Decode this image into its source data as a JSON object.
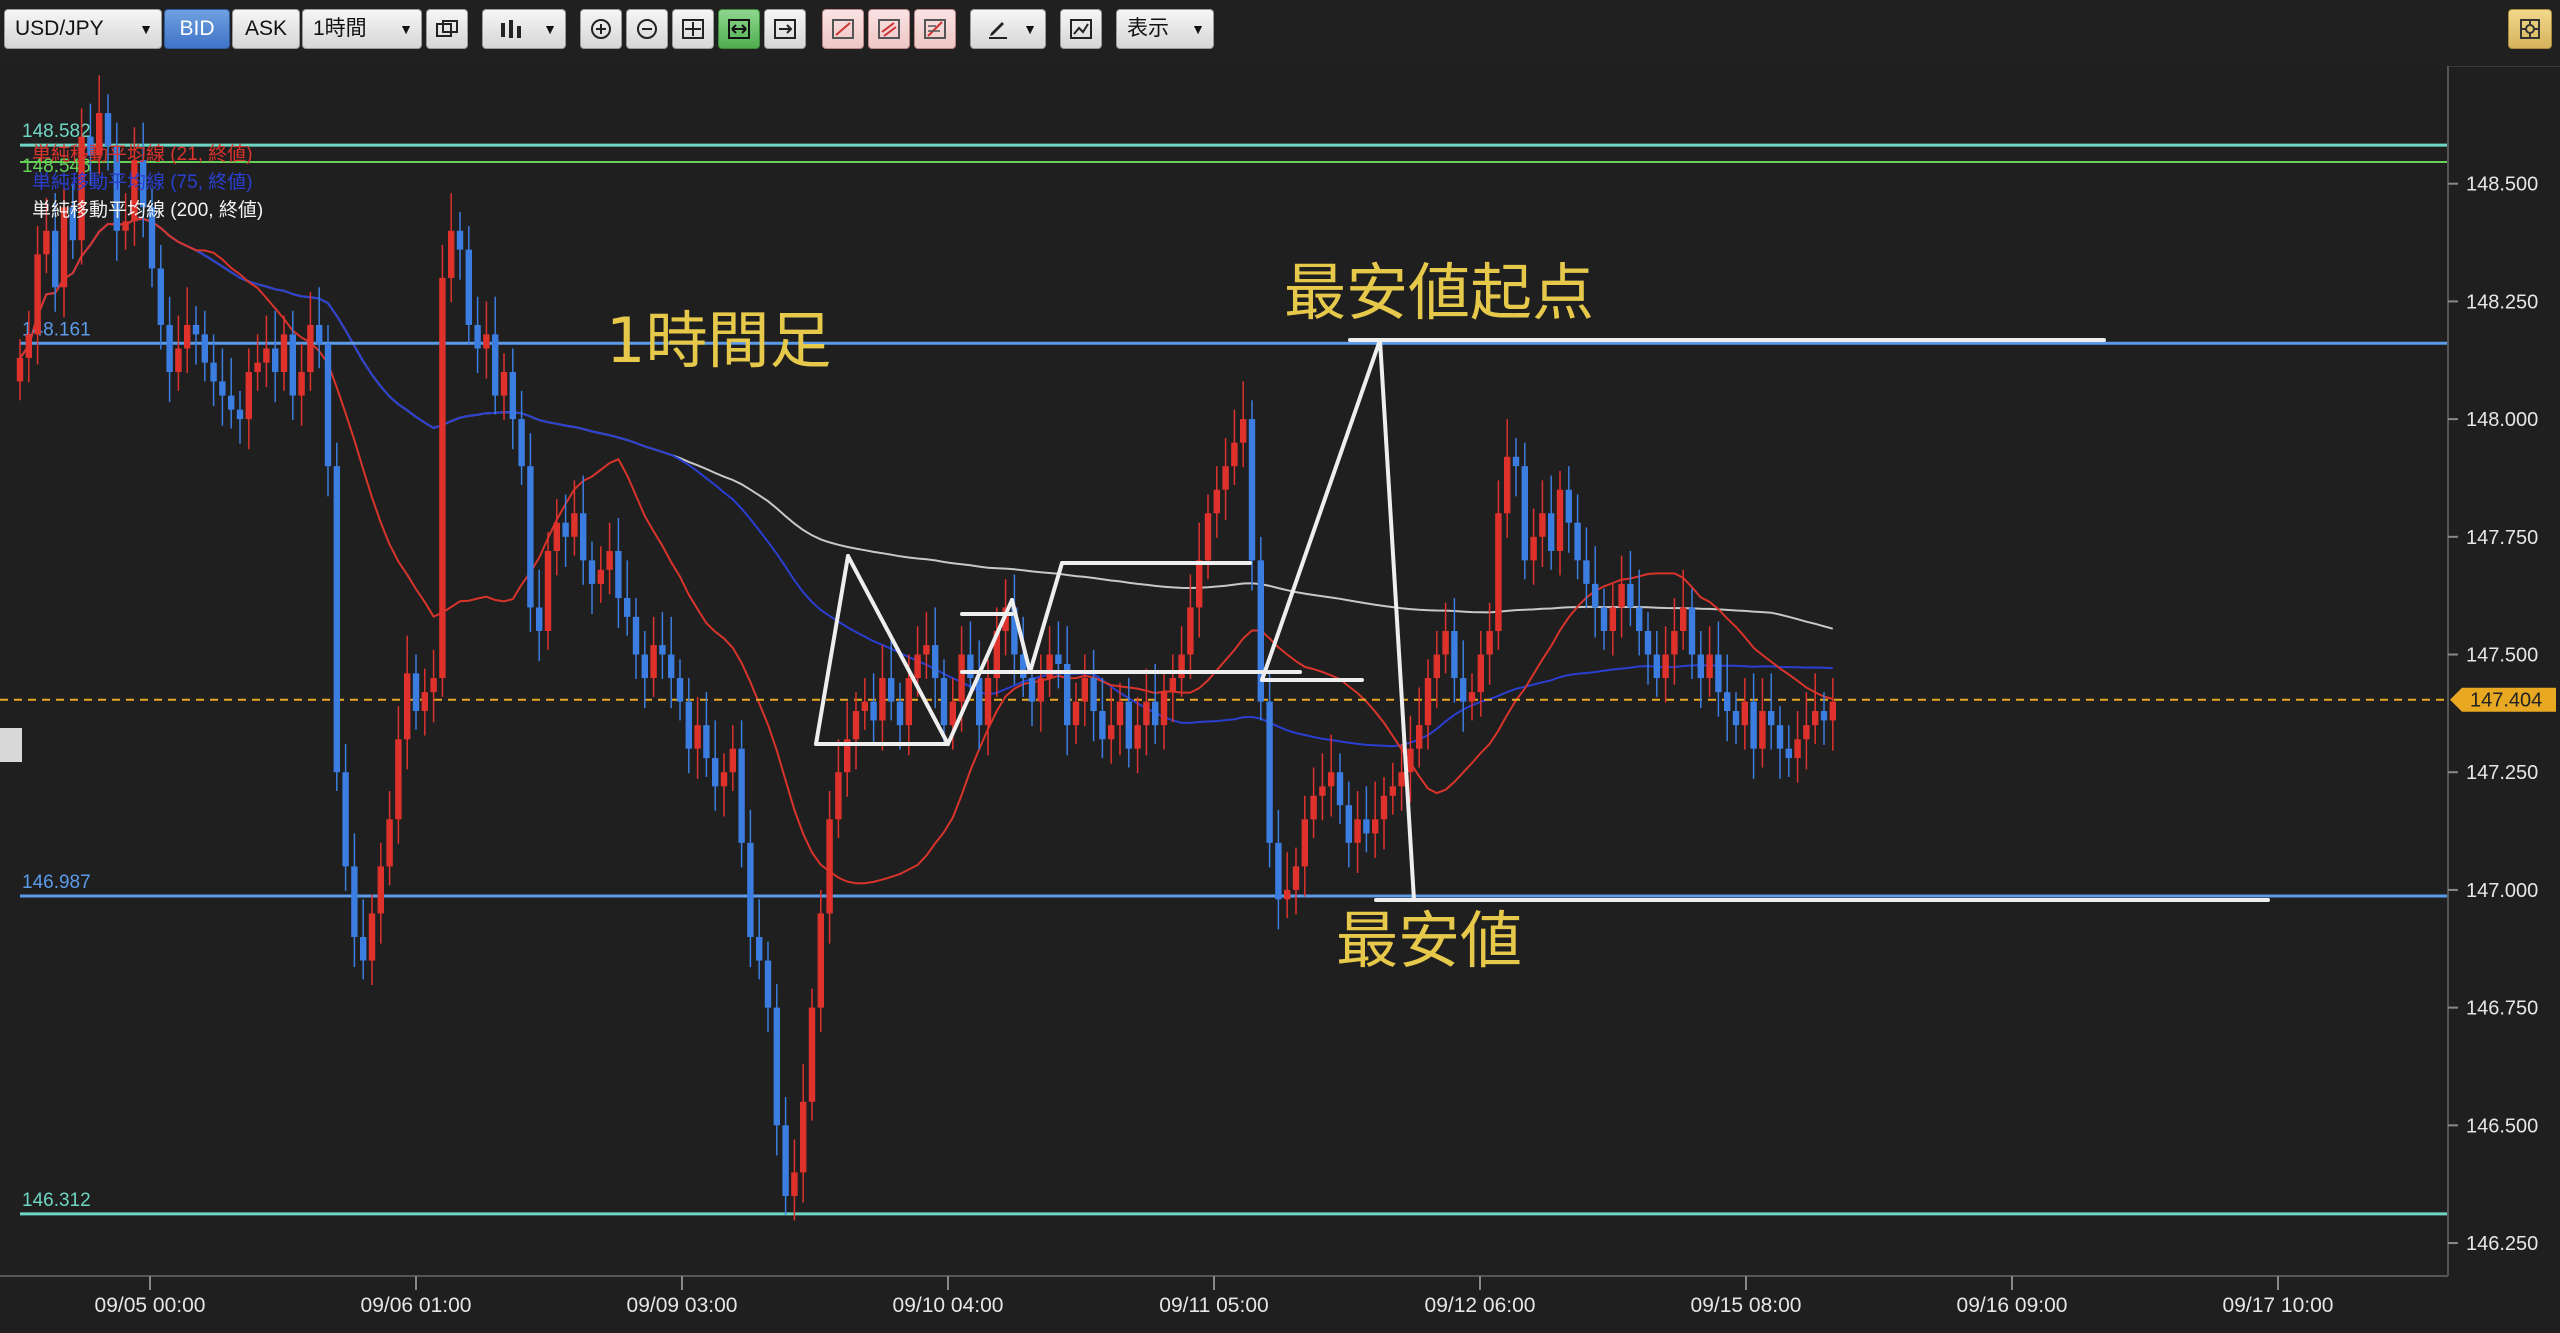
{
  "toolbar": {
    "symbol": "USD/JPY",
    "bid_label": "BID",
    "ask_label": "ASK",
    "timeframe": "1時間",
    "display_label": "表示"
  },
  "colors": {
    "background": "#1f1f1f",
    "up_candle": "#e0322d",
    "down_candle": "#3b7de0",
    "ma21": "#d8342c",
    "ma75": "#2a3fd0",
    "ma200": "#c8c8c8",
    "hline_blue": "#5b9bea",
    "hline_teal": "#6fd6c4",
    "hline_green": "#67d05a",
    "annotation": "#e6c84a",
    "drawing": "#eeeeee",
    "current_price": "#e8a822"
  },
  "chart_data": {
    "type": "candlestick",
    "title": "1時間足",
    "symbol": "USD/JPY",
    "timeframe": "1時間",
    "ylim": [
      146.18,
      148.75
    ],
    "yticks": [
      "148.500",
      "148.250",
      "148.000",
      "147.750",
      "147.500",
      "147.250",
      "147.000",
      "146.750",
      "146.500",
      "146.250"
    ],
    "ytick_values": [
      148.5,
      148.25,
      148.0,
      147.75,
      147.5,
      147.25,
      147.0,
      146.75,
      146.5,
      146.25
    ],
    "xticks": [
      "09/05 00:00",
      "09/06 01:00",
      "09/09 03:00",
      "09/10 04:00",
      "09/11 05:00",
      "09/12 06:00",
      "09/15 08:00",
      "09/16 09:00",
      "09/17 10:00"
    ],
    "legend": [
      "単純移動平均線 (21, 終値)",
      "単純移動平均線 (75, 終値)",
      "単純移動平均線 (200, 終値)"
    ],
    "horizontal_lines": [
      {
        "label": "148.582",
        "value": 148.582,
        "style": "teal"
      },
      {
        "label": "148.546",
        "value": 148.546,
        "style": "green"
      },
      {
        "label": "148.161",
        "value": 148.161,
        "style": "blue"
      },
      {
        "label": "146.987",
        "value": 146.987,
        "style": "blue"
      },
      {
        "label": "146.312",
        "value": 146.312,
        "style": "teal"
      }
    ],
    "current_price": {
      "label": "147.404",
      "value": 147.404
    },
    "annotations": [
      {
        "text": "1時間足"
      },
      {
        "text": "最安値起点"
      },
      {
        "text": "最安値"
      }
    ],
    "closes": [
      148.13,
      148.18,
      148.35,
      148.4,
      148.28,
      148.45,
      148.38,
      148.6,
      148.56,
      148.65,
      148.58,
      148.4,
      148.42,
      148.55,
      148.45,
      148.32,
      148.2,
      148.1,
      148.15,
      148.2,
      148.18,
      148.12,
      148.08,
      148.05,
      148.02,
      148.0,
      148.1,
      148.12,
      148.15,
      148.1,
      148.18,
      148.05,
      148.1,
      148.2,
      148.16,
      147.9,
      147.25,
      147.05,
      146.9,
      146.85,
      146.95,
      147.05,
      147.15,
      147.32,
      147.46,
      147.38,
      147.42,
      147.45,
      148.3,
      148.4,
      148.36,
      148.2,
      148.15,
      148.18,
      148.05,
      148.1,
      148.0,
      147.9,
      147.6,
      147.55,
      147.72,
      147.78,
      147.75,
      147.8,
      147.7,
      147.65,
      147.68,
      147.72,
      147.62,
      147.58,
      147.5,
      147.45,
      147.52,
      147.5,
      147.45,
      147.4,
      147.3,
      147.35,
      147.28,
      147.22,
      147.25,
      147.3,
      147.1,
      146.9,
      146.85,
      146.75,
      146.5,
      146.35,
      146.4,
      146.55,
      146.75,
      146.95,
      147.15,
      147.25,
      147.32,
      147.38,
      147.4,
      147.36,
      147.45,
      147.4,
      147.35,
      147.45,
      147.5,
      147.52,
      147.45,
      147.35,
      147.4,
      147.5,
      147.45,
      147.35,
      147.45,
      147.55,
      147.6,
      147.5,
      147.45,
      147.4,
      147.45,
      147.5,
      147.48,
      147.35,
      147.4,
      147.45,
      147.38,
      147.32,
      147.35,
      147.4,
      147.3,
      147.35,
      147.4,
      147.35,
      147.42,
      147.45,
      147.5,
      147.6,
      147.7,
      147.8,
      147.85,
      147.9,
      147.95,
      148.0,
      147.7,
      147.4,
      147.1,
      146.98,
      147.0,
      147.05,
      147.15,
      147.2,
      147.22,
      147.25,
      147.18,
      147.1,
      147.15,
      147.12,
      147.15,
      147.2,
      147.22,
      147.25,
      147.3,
      147.35,
      147.45,
      147.5,
      147.55,
      147.45,
      147.4,
      147.42,
      147.5,
      147.55,
      147.8,
      147.92,
      147.9,
      147.7,
      147.75,
      147.8,
      147.72,
      147.85,
      147.78,
      147.7,
      147.65,
      147.6,
      147.55,
      147.6,
      147.65,
      147.6,
      147.55,
      147.5,
      147.45,
      147.5,
      147.55,
      147.6,
      147.5,
      147.45,
      147.5,
      147.42,
      147.38,
      147.35,
      147.4,
      147.3,
      147.38,
      147.35,
      147.3,
      147.28,
      147.32,
      147.35,
      147.38,
      147.36,
      147.4
    ]
  }
}
